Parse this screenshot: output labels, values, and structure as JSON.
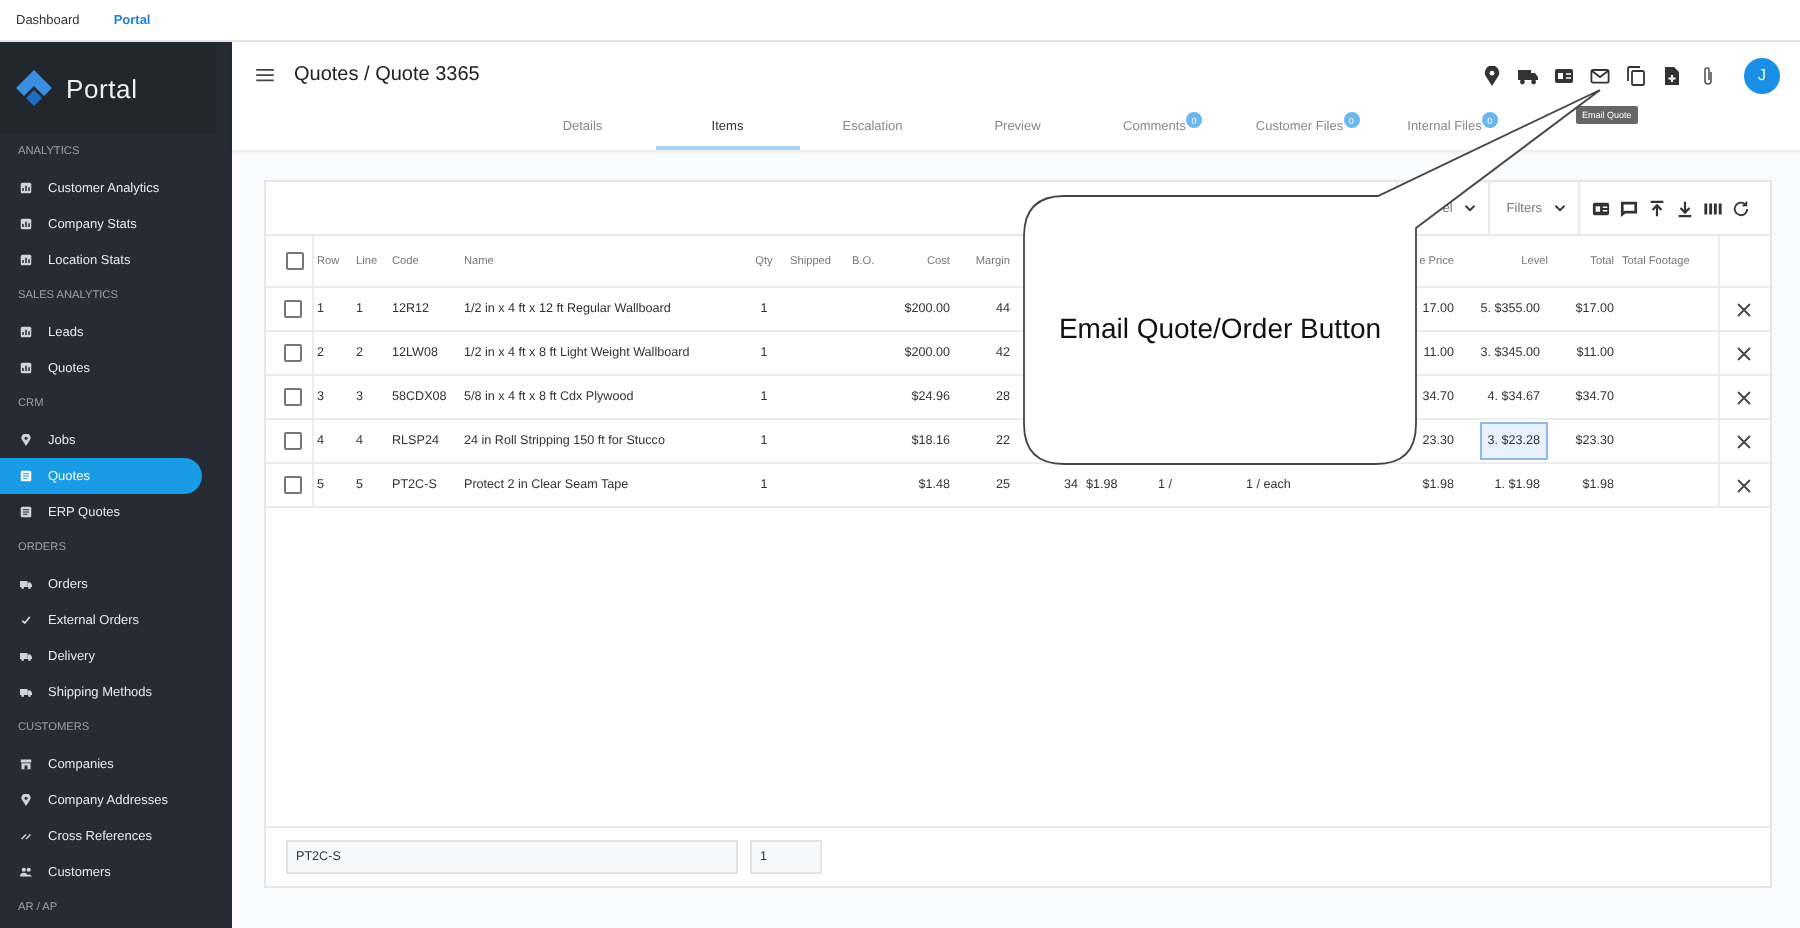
{
  "top_nav": [
    {
      "label": "Dashboard",
      "selected": false
    },
    {
      "label": "Portal",
      "selected": true
    }
  ],
  "sidebar": {
    "logo_text": "Portal",
    "sections": [
      {
        "title": "ANALYTICS",
        "items": [
          {
            "label": "Customer Analytics",
            "kind": "report",
            "selected": false
          },
          {
            "label": "Company Stats",
            "kind": "report",
            "selected": false
          },
          {
            "label": "Location Stats",
            "kind": "report",
            "selected": false
          }
        ]
      },
      {
        "title": "SALES ANALYTICS",
        "items": [
          {
            "label": "Leads",
            "kind": "report",
            "selected": false
          },
          {
            "label": "Quotes",
            "kind": "report",
            "selected": false
          }
        ]
      },
      {
        "title": "CRM",
        "items": [
          {
            "label": "Jobs",
            "kind": "pin",
            "selected": false
          },
          {
            "label": "Quotes",
            "kind": "doc",
            "selected": true
          },
          {
            "label": "ERP Quotes",
            "kind": "doc",
            "selected": false
          }
        ]
      },
      {
        "title": "ORDERS",
        "items": [
          {
            "label": "Orders",
            "kind": "truck",
            "selected": false
          },
          {
            "label": "External Orders",
            "kind": "check",
            "selected": false
          },
          {
            "label": "Delivery",
            "kind": "truck",
            "selected": false
          },
          {
            "label": "Shipping Methods",
            "kind": "truck",
            "selected": false
          }
        ]
      },
      {
        "title": "CUSTOMERS",
        "items": [
          {
            "label": "Companies",
            "kind": "building",
            "selected": false
          },
          {
            "label": "Company Addresses",
            "kind": "pin",
            "selected": false
          },
          {
            "label": "Cross References",
            "kind": "swap",
            "selected": false
          },
          {
            "label": "Customers",
            "kind": "people",
            "selected": false
          }
        ]
      },
      {
        "title": "AR / AP"
      }
    ]
  },
  "header": {
    "title": "Quotes / Quote 3365",
    "avatar": "J",
    "tooltip": "Email Quote"
  },
  "tabs": [
    {
      "label": "Details",
      "selected": false
    },
    {
      "label": "Items",
      "selected": true
    },
    {
      "label": "Escalation",
      "selected": false
    },
    {
      "label": "Preview",
      "selected": false
    },
    {
      "label": "Comments",
      "selected": false,
      "badge": "0"
    },
    {
      "label": "Customer Files",
      "selected": false,
      "badge": "0"
    },
    {
      "label": "Internal Files",
      "selected": false,
      "badge": "0"
    }
  ],
  "toolbar": {
    "dropdown": "el",
    "filters": "Filters"
  },
  "table": {
    "header_checked": false,
    "columns": [
      "Row",
      "Line",
      "Code",
      "Name",
      "Qty",
      "Shipped",
      "B.O.",
      "Cost",
      "Margin",
      null,
      null,
      null,
      null,
      "e Price",
      "Level",
      "Total",
      "Total Footage"
    ],
    "rows": [
      {
        "checked": false,
        "level_selected": false,
        "cells": [
          "1",
          "1",
          "12R12",
          "1/2 in x 4 ft x 12 ft Regular Wallboard",
          "1",
          null,
          null,
          "$200.00",
          "44",
          null,
          null,
          null,
          null,
          "17.00",
          "5. $355.00",
          "$17.00",
          null
        ]
      },
      {
        "checked": false,
        "level_selected": false,
        "cells": [
          "2",
          "2",
          "12LW08",
          "1/2 in x 4 ft x 8 ft Light Weight Wallboard",
          "1",
          null,
          null,
          "$200.00",
          "42",
          null,
          null,
          null,
          null,
          "11.00",
          "3. $345.00",
          "$11.00",
          null
        ]
      },
      {
        "checked": false,
        "level_selected": false,
        "cells": [
          "3",
          "3",
          "58CDX08",
          "5/8 in x 4 ft x 8 ft Cdx Plywood",
          "1",
          null,
          null,
          "$24.96",
          "28",
          null,
          null,
          null,
          null,
          "34.70",
          "4. $34.67",
          "$34.70",
          null
        ]
      },
      {
        "checked": false,
        "level_selected": true,
        "cells": [
          "4",
          "4",
          "RLSP24",
          "24 in Roll Stripping 150 ft for Stucco",
          "1",
          null,
          null,
          "$18.16",
          "22",
          null,
          null,
          null,
          null,
          "23.30",
          "3. $23.28",
          "$23.30",
          null
        ]
      },
      {
        "checked": false,
        "level_selected": false,
        "cells": [
          "5",
          "5",
          "PT2C-S",
          "Protect 2 in Clear Seam Tape",
          "1",
          null,
          null,
          "$1.48",
          "25",
          "34",
          "$1.98",
          "1 /",
          "1 / each",
          "$1.98",
          "1. $1.98",
          "$1.98",
          null
        ]
      }
    ]
  },
  "footer": {
    "code_value": "PT2C-S",
    "qty_value": "1"
  },
  "callout": {
    "text": "Email Quote/Order Button"
  }
}
